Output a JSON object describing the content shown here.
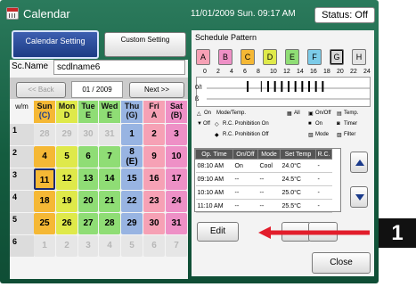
{
  "title_bar": {
    "app_name": "Calendar",
    "datetime": "11/01/2009 Sun. 09:17 AM",
    "status": "Status: Off"
  },
  "tabs": {
    "calendar_setting": "Calendar Setting",
    "custom_setting": "Custom Setting"
  },
  "schedule": {
    "name_label": "Sc.Name",
    "name_value": "scdlname6"
  },
  "calendar_nav": {
    "back": "<< Back",
    "month": "01 / 2009",
    "next": "Next >>"
  },
  "calendar": {
    "week_label": "w/m",
    "days": [
      {
        "name": "Sun",
        "pattern": "(C)",
        "color": "#f5b835"
      },
      {
        "name": "Mon",
        "pattern": "D",
        "color": "#dfe94a"
      },
      {
        "name": "Tue",
        "pattern": "E",
        "color": "#8fdd75"
      },
      {
        "name": "Wed",
        "pattern": "E",
        "color": "#8fdd75"
      },
      {
        "name": "Thu",
        "pattern": "(G)",
        "color": "#98b4e2"
      },
      {
        "name": "Fri",
        "pattern": "A",
        "color": "#f6a1b5"
      },
      {
        "name": "Sat",
        "pattern": "(B)",
        "color": "#ee90c6"
      }
    ],
    "weeks": [
      {
        "num": "1",
        "cells": [
          {
            "t": "28",
            "m": true
          },
          {
            "t": "29",
            "m": true
          },
          {
            "t": "30",
            "m": true
          },
          {
            "t": "31",
            "m": true
          },
          {
            "t": "1",
            "m": false
          },
          {
            "t": "2",
            "m": false
          },
          {
            "t": "3",
            "m": false
          }
        ]
      },
      {
        "num": "2",
        "cells": [
          {
            "t": "4",
            "m": false
          },
          {
            "t": "5",
            "m": false
          },
          {
            "t": "6",
            "m": false
          },
          {
            "t": "7",
            "m": false
          },
          {
            "t": "8\n(E)",
            "m": false
          },
          {
            "t": "9",
            "m": false
          },
          {
            "t": "10",
            "m": false
          }
        ]
      },
      {
        "num": "3",
        "cells": [
          {
            "t": "11",
            "m": false
          },
          {
            "t": "12",
            "m": false
          },
          {
            "t": "13",
            "m": false
          },
          {
            "t": "14",
            "m": false
          },
          {
            "t": "15",
            "m": false
          },
          {
            "t": "16",
            "m": false
          },
          {
            "t": "17",
            "m": false
          }
        ]
      },
      {
        "num": "4",
        "cells": [
          {
            "t": "18",
            "m": false
          },
          {
            "t": "19",
            "m": false
          },
          {
            "t": "20",
            "m": false
          },
          {
            "t": "21",
            "m": false
          },
          {
            "t": "22",
            "m": false
          },
          {
            "t": "23",
            "m": false
          },
          {
            "t": "24",
            "m": false
          }
        ]
      },
      {
        "num": "5",
        "cells": [
          {
            "t": "25",
            "m": false
          },
          {
            "t": "26",
            "m": false
          },
          {
            "t": "27",
            "m": false
          },
          {
            "t": "28",
            "m": false
          },
          {
            "t": "29",
            "m": false
          },
          {
            "t": "30",
            "m": false
          },
          {
            "t": "31",
            "m": false
          }
        ]
      },
      {
        "num": "6",
        "cells": [
          {
            "t": "1",
            "m": true
          },
          {
            "t": "2",
            "m": true
          },
          {
            "t": "3",
            "m": true
          },
          {
            "t": "4",
            "m": true
          },
          {
            "t": "5",
            "m": true
          },
          {
            "t": "6",
            "m": true
          },
          {
            "t": "7",
            "m": true
          }
        ]
      }
    ],
    "selected_date": "11"
  },
  "schedule_pattern": {
    "title": "Schedule Pattern",
    "buttons": [
      {
        "label": "A",
        "color": "#f6a1b5"
      },
      {
        "label": "B",
        "color": "#ee90c6"
      },
      {
        "label": "C",
        "color": "#f5b835"
      },
      {
        "label": "D",
        "color": "#dfe94a"
      },
      {
        "label": "E",
        "color": "#8fdd75"
      },
      {
        "label": "F",
        "color": "#7ccbe8"
      },
      {
        "label": "G",
        "color": "#d5d5d5"
      },
      {
        "label": "H",
        "color": "#e3e3e3"
      }
    ],
    "selected": "G",
    "time_axis": [
      "0",
      "2",
      "4",
      "6",
      "8",
      "10",
      "12",
      "14",
      "16",
      "18",
      "20",
      "22",
      "24"
    ],
    "row_labels": [
      "0/I",
      "ß"
    ]
  },
  "legend": {
    "on": "On",
    "off": "Off",
    "mode_temp": "Mode/Temp.",
    "rc_prohibition_on": "R.C. Prohibition On",
    "rc_prohibition_off": "R.C. Prohibition Off",
    "all": "All",
    "on_off": "On/Off",
    "temp": "Temp.",
    "on2": "On",
    "timer": "Timer",
    "mode": "Mode",
    "filter": "Filter"
  },
  "op_table": {
    "headers": [
      "Op. Time",
      "On/Off",
      "Mode",
      "Set Temp",
      "R.C."
    ],
    "rows": [
      [
        "08:10 AM",
        "On",
        "Cool",
        "24.0°C",
        "-"
      ],
      [
        "09:10 AM",
        "--",
        "--",
        "24.5°C",
        "-"
      ],
      [
        "10:10 AM",
        "--",
        "--",
        "25.0°C",
        "-"
      ],
      [
        "11:10 AM",
        "--",
        "--",
        "25.5°C",
        "-"
      ]
    ]
  },
  "buttons": {
    "edit": "Edit",
    "close": "Close"
  },
  "callout": {
    "number": "1",
    "color": "#e21d2b"
  }
}
